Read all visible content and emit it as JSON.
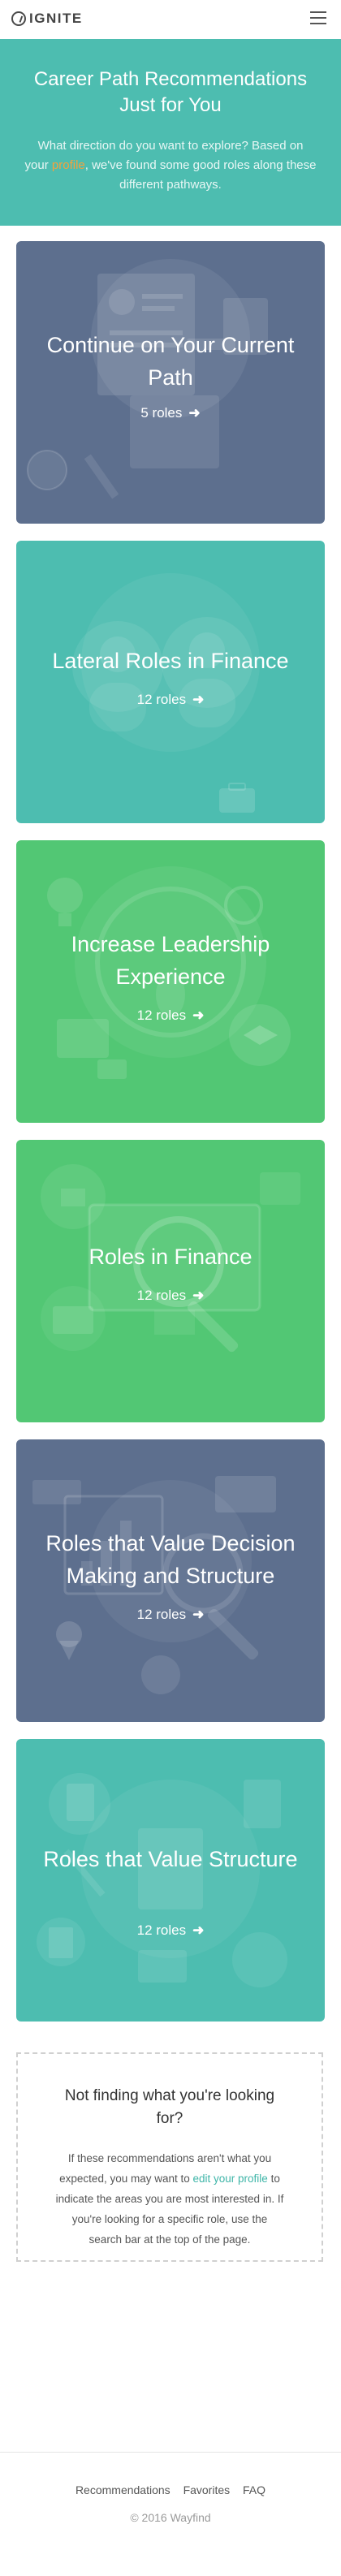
{
  "header": {
    "logo_text": "IGNITE",
    "menu_icon": "hamburger-menu-icon"
  },
  "hero": {
    "title": "Career Path Recommendations Just for You",
    "intro_before": "What direction do you want to explore? Based on your ",
    "profile_link": "profile",
    "intro_after": ", we've found some good roles along these different pathways."
  },
  "cards": [
    {
      "title": "Continue on Your Current Path",
      "roles": "5 roles",
      "color": "#5d6f8e",
      "icon": "resume-cv-illustration"
    },
    {
      "title": "Lateral Roles in Finance",
      "roles": "12 roles",
      "color": "#4dbdb0",
      "icon": "people-briefcase-illustration"
    },
    {
      "title": "Increase Leadership Experience",
      "roles": "12 roles",
      "color": "#52c774",
      "icon": "lightbulb-graduation-illustration"
    },
    {
      "title": "Roles in Finance",
      "roles": "12 roles",
      "color": "#52c774",
      "icon": "magnifier-monitor-illustration"
    },
    {
      "title": "Roles that Value Decision Making and Structure",
      "roles": "12 roles",
      "color": "#5d6f8e",
      "icon": "chart-map-pin-illustration"
    },
    {
      "title": "Roles that Value Structure",
      "roles": "12 roles",
      "color": "#4dbdb0",
      "icon": "documents-checklist-illustration"
    }
  ],
  "not_found": {
    "title": "Not finding what you're looking for?",
    "text_before": "If these recommendations aren't what you expected, you may want to ",
    "edit_link": "edit your profile",
    "text_after": " to indicate the areas you are most interested in. If you're looking for a specific role, use the search bar at the top of the page."
  },
  "footer": {
    "links": [
      "Recommendations",
      "Favorites",
      "FAQ"
    ],
    "copyright": "© 2016 Wayfind"
  },
  "colors": {
    "teal": "#4dbdb0",
    "slate": "#5d6f8e",
    "green": "#52c774",
    "link_orange": "#f4a23c"
  }
}
